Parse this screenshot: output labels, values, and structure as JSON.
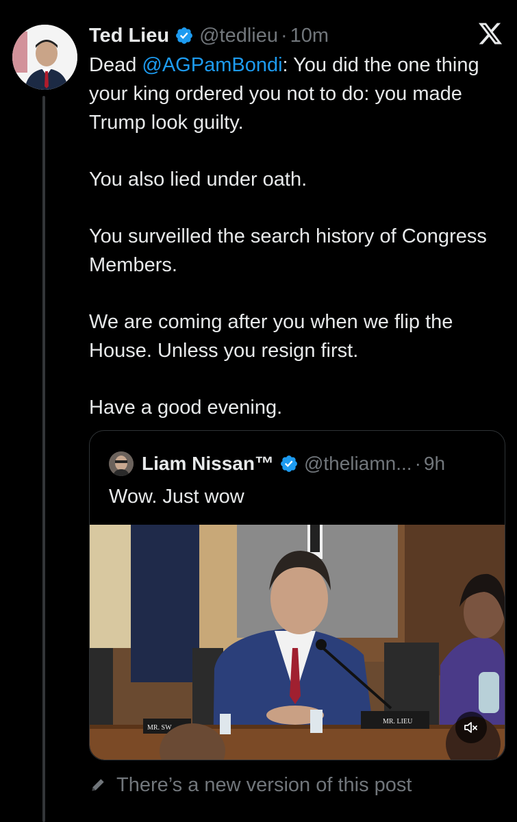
{
  "tweet": {
    "author_name": "Ted Lieu",
    "author_handle": "@tedlieu",
    "separator": "·",
    "time": "10m",
    "text_line1_prefix": "Dead ",
    "text_line1_mention": "@AGPamBondi",
    "text_line1_suffix": ": You did the one thing your king ordered you not to do: you made Trump look guilty.",
    "paragraph2": "You also lied under oath.",
    "paragraph3": "You surveilled the search history of Congress Members.",
    "paragraph4": "We are coming after you when we flip the House. Unless you resign first.",
    "paragraph5": "Have a good evening."
  },
  "quote": {
    "author_name": "Liam Nissan™",
    "author_handle": "@theliamn...",
    "separator": "·",
    "time": "9h",
    "text": "Wow. Just wow",
    "nameplate_left": "MR. SW",
    "nameplate_center": "MR. LIEU"
  },
  "footer": {
    "new_version_text": "There’s a new version of this post"
  },
  "icons": {
    "verified": "verified-badge-icon",
    "close": "x-logo-icon",
    "mute": "speaker-muted-icon",
    "edit": "pencil-icon"
  },
  "colors": {
    "background": "#000000",
    "text": "#e7e9ea",
    "secondary": "#71767b",
    "accent": "#1d9bf0",
    "border": "#2f3336"
  }
}
